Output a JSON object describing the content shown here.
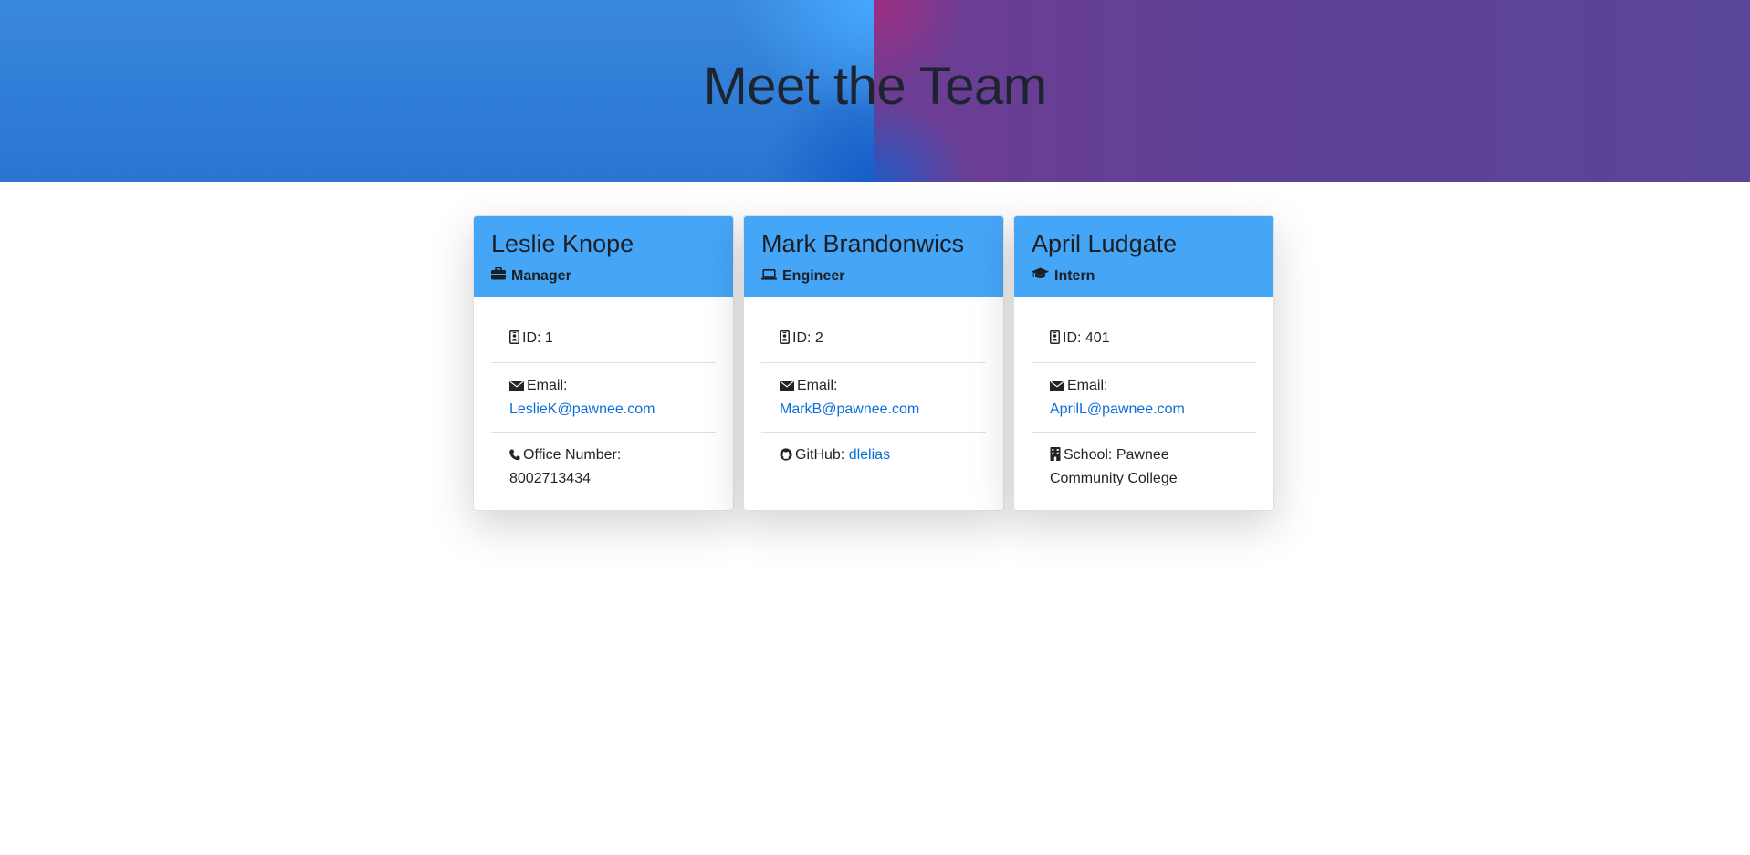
{
  "hero": {
    "title": "Meet the Team"
  },
  "team": [
    {
      "name": "Leslie Knope",
      "role": "Manager",
      "role_icon": "briefcase-icon",
      "id_label": "ID: 1",
      "email_label": "Email:",
      "email": "LeslieK@pawnee.com",
      "extra_label": "Office Number:",
      "extra_value": "8002713434",
      "extra_icon": "phone-icon"
    },
    {
      "name": "Mark Brandonwics",
      "role": "Engineer",
      "role_icon": "laptop-icon",
      "id_label": "ID: 2",
      "email_label": "Email:",
      "email": "MarkB@pawnee.com",
      "extra_label": "GitHub:",
      "extra_value": "dlelias",
      "extra_icon": "github-icon"
    },
    {
      "name": "April Ludgate",
      "role": "Intern",
      "role_icon": "graduation-cap-icon",
      "id_label": "ID: 401",
      "email_label": "Email:",
      "email": "AprilL@pawnee.com",
      "extra_label": "School:",
      "extra_value": "Pawnee Community College",
      "extra_icon": "building-icon"
    }
  ],
  "colors": {
    "card_header": "#45a5f7",
    "link": "#0d6ed8",
    "hero_left": "#2f7dd6",
    "hero_right": "#5e4197"
  }
}
